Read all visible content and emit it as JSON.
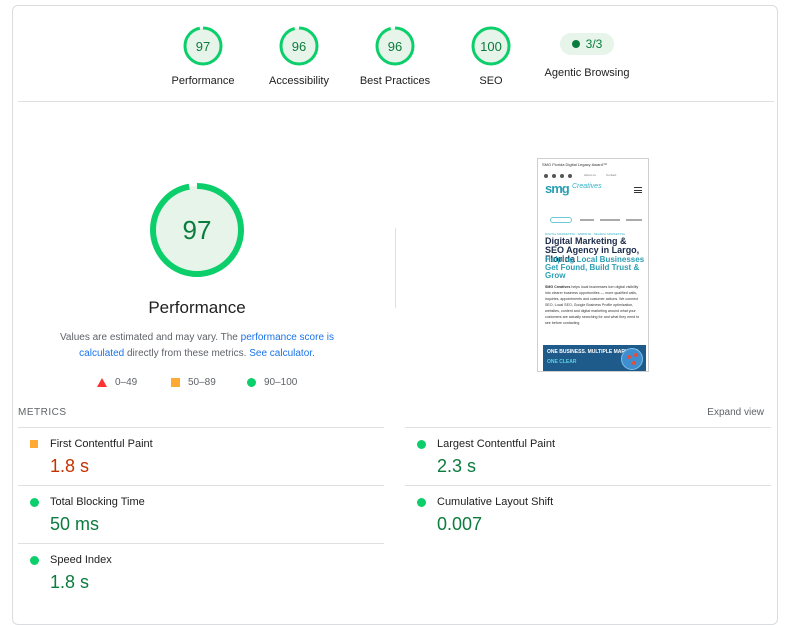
{
  "gauges": [
    {
      "score": "97",
      "label": "Performance"
    },
    {
      "score": "96",
      "label": "Accessibility"
    },
    {
      "score": "96",
      "label": "Best Practices"
    },
    {
      "score": "100",
      "label": "SEO"
    }
  ],
  "agentic": {
    "value": "3/3",
    "label": "Agentic Browsing"
  },
  "performance": {
    "score": "97",
    "title": "Performance",
    "desc_prefix": "Values are estimated and may vary. The ",
    "desc_link": "performance score is calculated",
    "desc_middle": " directly from these metrics. ",
    "calc_link": "See calculator.",
    "score_fraction": 0.97
  },
  "legend": {
    "fail": "0–49",
    "average": "50–89",
    "pass": "90–100"
  },
  "screenshot": {
    "award": "SMG Florida Digital Legacy Award™",
    "nav_about": "About us",
    "nav_contact": "Contact",
    "logo": "smg",
    "logo_sub": "Creatives",
    "kicker": "DIGITAL MARKETING · WEBSITE · SEARCH MARKETING",
    "headline": "Digital Marketing & SEO Agency in Largo, Florida",
    "subhead": "Helping Local Businesses Get Found, Build Trust & Grow",
    "body_lead": "SMG Creatives",
    "body": " helps local businesses turn digital visibility into clearer business opportunities — more qualified calls, inquiries, appointments and customer actions. We connect SEO, Local SEO, Google Business Profile optimization, websites, content and digital marketing around what your customers are actually searching for and what they need to see before contacting",
    "banner_line1": "ONE BUSINESS. MULTIPLE MARKETS.",
    "banner_line2": "ONE CLEAR"
  },
  "metrics_section": {
    "title": "METRICS",
    "expand": "Expand view"
  },
  "metrics": {
    "fcp": {
      "label": "First Contentful Paint",
      "value": "1.8 s"
    },
    "lcp": {
      "label": "Largest Contentful Paint",
      "value": "2.3 s"
    },
    "tbt": {
      "label": "Total Blocking Time",
      "value": "50 ms"
    },
    "cls": {
      "label": "Cumulative Layout Shift",
      "value": "0.007"
    },
    "si": {
      "label": "Speed Index",
      "value": "1.8 s"
    }
  },
  "colors": {
    "pass": "#0cce6b",
    "pass_text": "#0c7b3e",
    "average": "#ffaa33",
    "average_text": "#c33300",
    "fail": "#ff3333",
    "link": "#1a73e8"
  }
}
